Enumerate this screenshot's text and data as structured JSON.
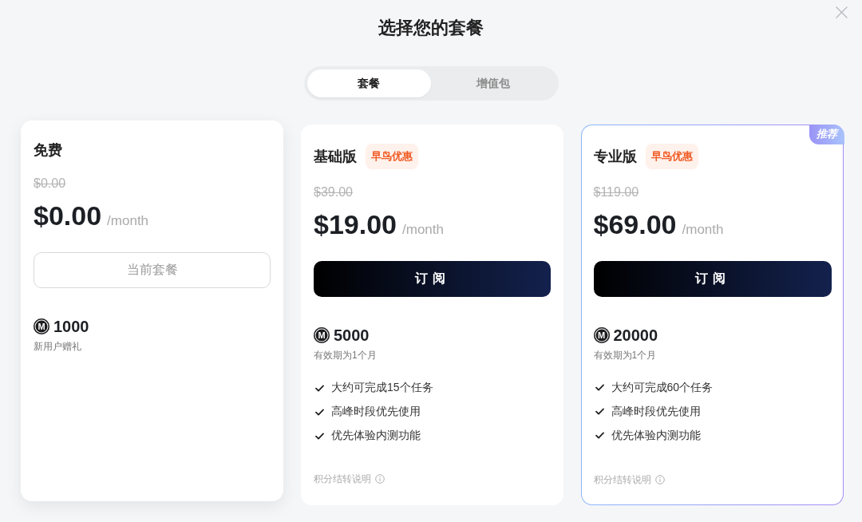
{
  "dialog": {
    "title": "选择您的套餐"
  },
  "tabs": [
    {
      "label": "套餐",
      "selected": true
    },
    {
      "label": "增值包",
      "selected": false
    }
  ],
  "plans": [
    {
      "name": "免费",
      "current": true,
      "recommended": false,
      "original_price": "$0.00",
      "price": "$0.00",
      "period": "/month",
      "button": "当前套餐",
      "credits": {
        "symbol": "M",
        "amount": "1000",
        "note": "新用户赠礼"
      }
    },
    {
      "name": "基础版",
      "current": false,
      "recommended": false,
      "promo_tag": "早鸟优惠",
      "original_price": "$39.00",
      "price": "$19.00",
      "period": "/month",
      "button": "订阅",
      "credits": {
        "symbol": "M",
        "amount": "5000",
        "note": "有效期为1个月"
      },
      "features": [
        "大约可完成15个任务",
        "高峰时段优先使用",
        "优先体验内测功能"
      ],
      "footer_link": "积分结转说明"
    },
    {
      "name": "专业版",
      "current": false,
      "recommended": true,
      "ribbon": "推荐",
      "promo_tag": "早鸟优惠",
      "original_price": "$119.00",
      "price": "$69.00",
      "period": "/month",
      "button": "订阅",
      "credits": {
        "symbol": "M",
        "amount": "20000",
        "note": "有效期为1个月"
      },
      "features": [
        "大约可完成60个任务",
        "高峰时段优先使用",
        "优先体验内测功能"
      ],
      "footer_link": "积分结转说明"
    }
  ]
}
